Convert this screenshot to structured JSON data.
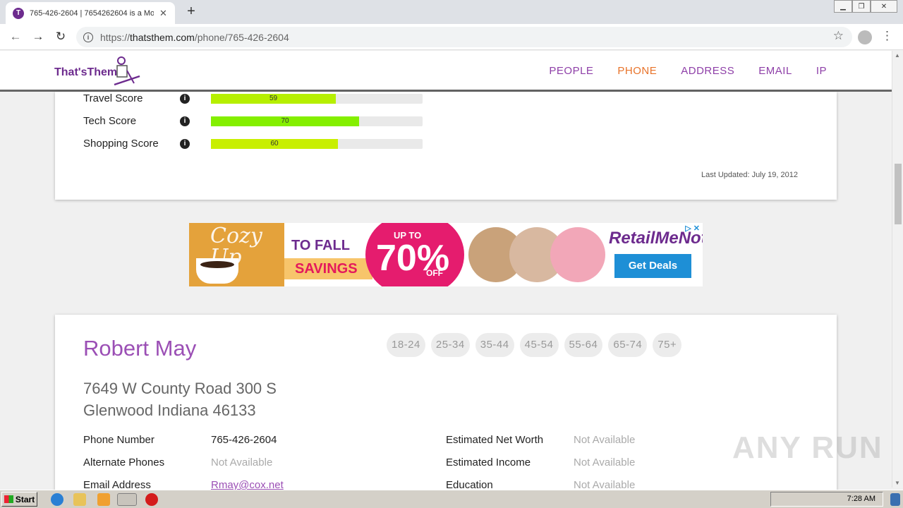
{
  "browser": {
    "tab_title": "765-426-2604 | 7654262604 is a Mo",
    "tab_favicon": "T",
    "url_prefix": "https://",
    "url_domain": "thatsthem.com",
    "url_path": "/phone/765-426-2604"
  },
  "site": {
    "logo_text": "That'sThem",
    "nav": [
      {
        "label": "PEOPLE"
      },
      {
        "label": "PHONE"
      },
      {
        "label": "ADDRESS"
      },
      {
        "label": "EMAIL"
      },
      {
        "label": "IP"
      }
    ],
    "active_color": "#e8732a",
    "brand_color": "#8e3fa8"
  },
  "scores": [
    {
      "label": "Travel Score",
      "value": 59,
      "color": "#b6ef00"
    },
    {
      "label": "Tech Score",
      "value": 70,
      "color": "#84ef00"
    },
    {
      "label": "Shopping Score",
      "value": 60,
      "color": "#c8ef00"
    }
  ],
  "last_updated": "Last Updated: July 19, 2012",
  "ad": {
    "cozy": "Cozy Up",
    "to_fall": "TO FALL",
    "savings": "SAVINGS",
    "up_to": "UP TO",
    "percent": "70%",
    "off": "OFF",
    "brand": "RetailMeNot",
    "cta": "Get Deals"
  },
  "person": {
    "name": "Robert May",
    "ages": [
      "18-24",
      "25-34",
      "35-44",
      "45-54",
      "55-64",
      "65-74",
      "75+"
    ],
    "address_line1": "7649 W County Road 300 S",
    "address_line2": "Glenwood Indiana 46133",
    "phone_label": "Phone Number",
    "phone_value": "765-426-2604",
    "alt_label": "Alternate Phones",
    "alt_value": "Not Available",
    "email_label": "Email Address",
    "email_value": "Rmay@cox.net",
    "networth_label": "Estimated Net Worth",
    "networth_value": "Not Available",
    "income_label": "Estimated Income",
    "income_value": "Not Available",
    "edu_label": "Education",
    "edu_value": "Not Available"
  },
  "watermark": "ANY RUN",
  "taskbar": {
    "start": "Start",
    "clock": "7:28 AM"
  }
}
